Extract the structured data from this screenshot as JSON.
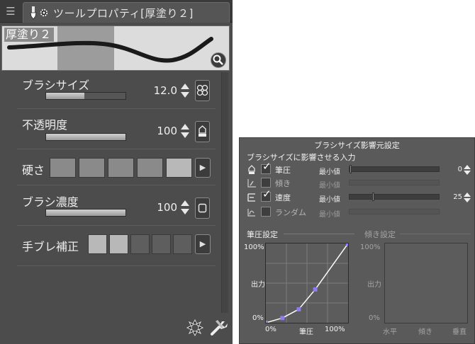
{
  "tool_property_panel": {
    "tab_title": "ツールプロパティ[厚塗り２]",
    "preview_name": "厚塗り２",
    "properties": [
      {
        "label": "ブラシサイズ",
        "value": "12.0",
        "level": 0.48,
        "button_icon": "brush-size-dynamics-icon"
      },
      {
        "label": "不透明度",
        "value": "100",
        "level": 1.0,
        "button_icon": "opacity-dynamics-icon"
      },
      {
        "label": "硬さ",
        "segments": 5,
        "selected": 5,
        "button_icon": "expand-arrow-icon"
      },
      {
        "label": "ブラシ濃度",
        "value": "100",
        "level": 1.0,
        "button_icon": "density-dynamics-icon"
      },
      {
        "label": "手ブレ補正",
        "segments": 5,
        "selected": 2,
        "button_icon": "expand-arrow-icon"
      }
    ],
    "bottom_icons": [
      "reset-icon",
      "settings-wrench-icon"
    ]
  },
  "brush_size_dynamics": {
    "title": "ブラシサイズ影響元設定",
    "subtitle": "ブラシサイズに影響させる入力",
    "inputs": [
      {
        "icon": "pen-pressure-icon",
        "label": "筆圧",
        "checked": true,
        "min_label": "最小値",
        "min_value": "0",
        "min_level": 0.0,
        "enabled": true
      },
      {
        "icon": "tilt-icon",
        "label": "傾き",
        "checked": false,
        "min_label": "最小値",
        "min_value": "",
        "min_level": 0.0,
        "enabled": false
      },
      {
        "icon": "speed-icon",
        "label": "速度",
        "checked": true,
        "min_label": "最小値",
        "min_value": "25",
        "min_level": 0.25,
        "enabled": true
      },
      {
        "icon": "random-icon",
        "label": "ランダム",
        "checked": false,
        "min_label": "最小値",
        "min_value": "",
        "min_level": 0.0,
        "enabled": false
      }
    ],
    "pressure_graph": {
      "title": "筆圧設定",
      "y_top": "100%",
      "y_mid": "出力",
      "y_bottom": "0%",
      "x_left": "0%",
      "x_mid": "筆圧",
      "x_right": "100%",
      "control_points": [
        [
          0,
          0
        ],
        [
          0.2,
          0.06
        ],
        [
          0.4,
          0.17
        ],
        [
          0.6,
          0.42
        ],
        [
          1.0,
          1.0
        ]
      ]
    },
    "tilt_graph": {
      "title": "傾き設定",
      "y_top": "100%",
      "y_mid": "出力",
      "y_bottom": "0%",
      "x_left": "水平",
      "x_mid": "傾き",
      "x_right": "垂直"
    },
    "colors": {
      "panel_bg": "#5a5a5a",
      "curve": "#ffffff",
      "control_point": "#8f7cf0",
      "graph_bg": "#5c5c5c"
    }
  }
}
